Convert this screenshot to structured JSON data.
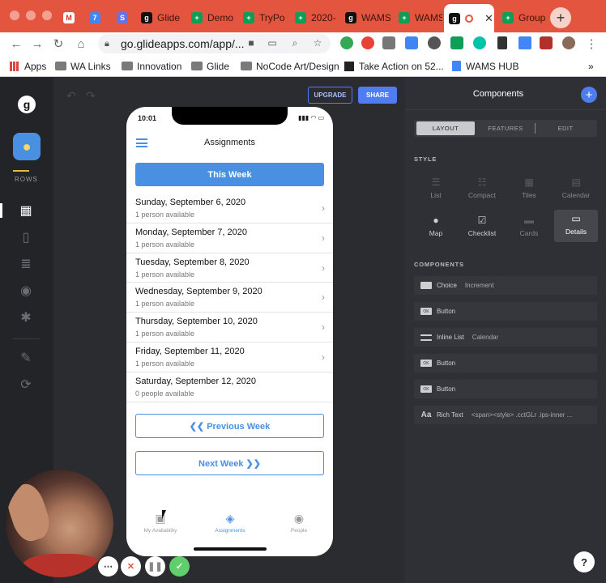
{
  "browser": {
    "tabs": [
      {
        "label": "",
        "icon": "gmail-icon",
        "color": "#ffffff",
        "glyph": "M"
      },
      {
        "label": "",
        "icon": "calendar-icon",
        "color": "#4285f4",
        "glyph": "7"
      },
      {
        "label": "",
        "icon": "stripe-icon",
        "color": "#6772e5",
        "glyph": "S"
      },
      {
        "label": "Glide",
        "icon": "glide-icon",
        "color": "#111111",
        "glyph": "g"
      },
      {
        "label": "Demo",
        "icon": "sheets-icon",
        "color": "#0f9d58",
        "glyph": "+"
      },
      {
        "label": "TryPo",
        "icon": "sheets-icon",
        "color": "#0f9d58",
        "glyph": "+"
      },
      {
        "label": "2020-",
        "icon": "sheets-icon",
        "color": "#0f9d58",
        "glyph": "+"
      },
      {
        "label": "WAMS",
        "icon": "glide-icon",
        "color": "#111111",
        "glyph": "g"
      },
      {
        "label": "WAMS",
        "icon": "sheets-icon",
        "color": "#0f9d58",
        "glyph": "+"
      },
      {
        "label": "",
        "icon": "glide-icon",
        "color": "#111111",
        "glyph": "g",
        "active": true
      },
      {
        "label": "Group",
        "icon": "sheets-icon",
        "color": "#0f9d58",
        "glyph": "+"
      }
    ],
    "url": "go.glideapps.com/app/...",
    "bookmarks": [
      {
        "label": "Apps",
        "icon": "apps-grid-icon"
      },
      {
        "label": "WA Links",
        "icon": "folder-icon"
      },
      {
        "label": "Innovation",
        "icon": "folder-icon"
      },
      {
        "label": "Glide",
        "icon": "folder-icon"
      },
      {
        "label": "NoCode Art/Design",
        "icon": "folder-icon"
      },
      {
        "label": "Take Action on 52...",
        "icon": "bookmark-page-icon"
      },
      {
        "label": "WAMS HUB",
        "icon": "docs-icon"
      }
    ],
    "more_bookmarks": "»"
  },
  "rail": {
    "rows_label": "ROWS"
  },
  "canvas": {
    "upgrade_label": "UPGRADE",
    "share_label": "SHARE"
  },
  "phone": {
    "status_time": "10:01",
    "title": "Assignments",
    "this_week": "This Week",
    "days": [
      {
        "title": "Sunday, September 6, 2020",
        "sub": "1 person available"
      },
      {
        "title": "Monday, September 7, 2020",
        "sub": "1 person available"
      },
      {
        "title": "Tuesday, September 8, 2020",
        "sub": "1 person available"
      },
      {
        "title": "Wednesday, September 9, 2020",
        "sub": "1 person available"
      },
      {
        "title": "Thursday, September 10, 2020",
        "sub": "1 person available"
      },
      {
        "title": "Friday, September 11, 2020",
        "sub": "1 person available"
      },
      {
        "title": "Saturday, September 12, 2020",
        "sub": "0 people available"
      }
    ],
    "prev_week": "❮❮ Previous Week",
    "next_week": "Next Week ❯❯",
    "tabbar": [
      {
        "label": "My Availability",
        "icon": "calendar-clock-icon"
      },
      {
        "label": "Assignments",
        "icon": "user-badge-icon",
        "active": true
      },
      {
        "label": "People",
        "icon": "people-icon"
      }
    ]
  },
  "panel": {
    "title": "Components",
    "tabs": {
      "layout": "LAYOUT",
      "features": "FEATURES",
      "edit": "EDIT"
    },
    "style_heading": "STYLE",
    "styles": [
      {
        "label": "List",
        "icon": "list-style-icon"
      },
      {
        "label": "Compact",
        "icon": "compact-style-icon"
      },
      {
        "label": "Tiles",
        "icon": "tiles-style-icon"
      },
      {
        "label": "Calendar",
        "icon": "calendar-style-icon"
      },
      {
        "label": "Map",
        "icon": "map-pin-icon"
      },
      {
        "label": "Checklist",
        "icon": "checklist-icon"
      },
      {
        "label": "Cards",
        "icon": "cards-style-icon"
      },
      {
        "label": "Details",
        "icon": "details-style-icon",
        "selected": true
      }
    ],
    "components_heading": "COMPONENTS",
    "components": [
      {
        "label": "Choice",
        "sub": "Increment",
        "icon": "choice-icon"
      },
      {
        "label": "Button",
        "sub": "",
        "icon": "button-icon"
      },
      {
        "label": "Inline List",
        "sub": "Calendar",
        "icon": "inline-list-icon"
      },
      {
        "label": "Button",
        "sub": "",
        "icon": "button-icon"
      },
      {
        "label": "Button",
        "sub": "",
        "icon": "button-icon"
      },
      {
        "label": "Rich Text",
        "sub": "<span><style> .cctGLr .ips-inner ...",
        "icon": "rich-text-icon"
      }
    ],
    "help": "?"
  },
  "colors": {
    "accent": "#4f7cf0",
    "phone_accent": "#4a90e2",
    "chrome_red": "#e4553f"
  }
}
